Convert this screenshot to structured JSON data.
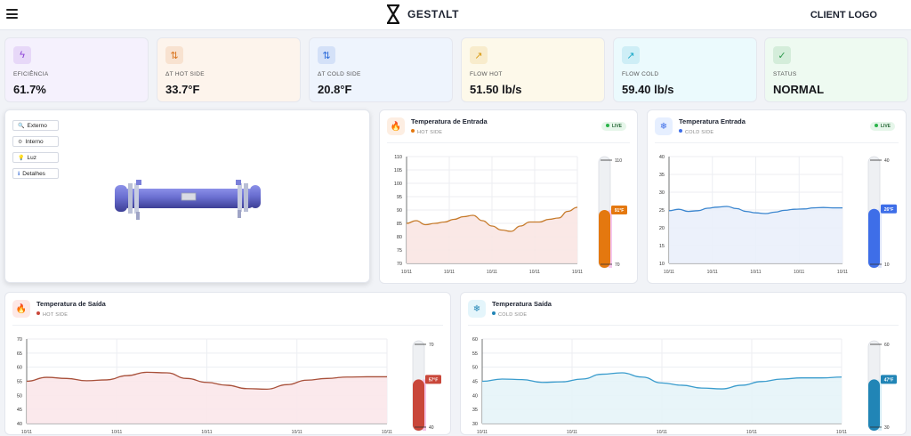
{
  "header": {
    "brand": "GESTΛLT",
    "client_logo": "CLIENT LOGO"
  },
  "kpis": [
    {
      "label": "EFICIÊNCIA",
      "value": "61.7%",
      "icon": "bolt-icon",
      "bg": "#f5f1fd",
      "accent": "#8b3fd6"
    },
    {
      "label": "ΔT HOT SIDE",
      "value": "33.7°F",
      "icon": "swap-vertical-icon",
      "bg": "#fdf4ec",
      "accent": "#d9731c"
    },
    {
      "label": "ΔT COLD SIDE",
      "value": "20.8°F",
      "icon": "swap-vertical-icon",
      "bg": "#eef4fd",
      "accent": "#2a6ad9"
    },
    {
      "label": "FLOW HOT",
      "value": "51.50 lb/s",
      "icon": "trend-up-icon",
      "bg": "#fdf9ea",
      "accent": "#d99a12"
    },
    {
      "label": "FLOW COLD",
      "value": "59.40 lb/s",
      "icon": "trend-up-icon",
      "bg": "#ebfafd",
      "accent": "#1aa8c8"
    },
    {
      "label": "STATUS",
      "value": "NORMAL",
      "icon": "check-circle-icon",
      "bg": "#eefaf1",
      "accent": "#2e9a4e"
    }
  ],
  "view_buttons": [
    {
      "label": "Externo",
      "icon": "search-icon"
    },
    {
      "label": "Interno",
      "icon": "gear-icon"
    },
    {
      "label": "Luz",
      "icon": "light-icon"
    },
    {
      "label": "Detalhes",
      "icon": "info-icon"
    }
  ],
  "live_label": "LIVE",
  "charts": [
    {
      "id": "c1",
      "title": "Temperatura de Entrada",
      "subtitle": "HOT SIDE",
      "icon": "flame-icon",
      "icon_bg": "#fdeee2",
      "color": "#c67a2a",
      "fill": "#f9e6e3",
      "thermo_color": "#e4780f",
      "thermo_glow": "#f6c7ee",
      "live": true,
      "gauge_value": "91°F",
      "gauge_max": "110",
      "gauge_min": "70",
      "chart_data": {
        "type": "area",
        "ylim": [
          70,
          110
        ],
        "yticks": [
          70,
          75,
          80,
          85,
          90,
          95,
          100,
          105,
          110
        ],
        "xticks": [
          "10/11",
          "10/11",
          "10/11",
          "10/11",
          "10/11"
        ],
        "values": [
          85,
          86,
          84.5,
          85,
          85.5,
          86.5,
          87.5,
          88,
          86,
          84,
          82.5,
          82,
          84,
          85.5,
          85.5,
          86.5,
          87,
          89.5,
          91
        ],
        "gauge_level": 0.52
      }
    },
    {
      "id": "c2",
      "title": "Temperatura Entrada",
      "subtitle": "COLD SIDE",
      "icon": "snowflake-icon",
      "icon_bg": "#e6efff",
      "color": "#3b86cf",
      "fill": "#eaf0fb",
      "thermo_color": "#3e6ee8",
      "thermo_glow": "#dfe6fb",
      "live": true,
      "gauge_value": "26°F",
      "gauge_max": "40",
      "gauge_min": "10",
      "chart_data": {
        "type": "area",
        "ylim": [
          10,
          40
        ],
        "yticks": [
          10,
          15,
          20,
          25,
          30,
          35,
          40
        ],
        "xticks": [
          "10/11",
          "10/11",
          "10/11",
          "10/11",
          "10/11"
        ],
        "values": [
          24.8,
          25.2,
          24.6,
          24.8,
          25.5,
          25.8,
          26,
          25.4,
          24.6,
          24.2,
          24.0,
          24.4,
          24.9,
          25.2,
          25.3,
          25.6,
          25.7,
          25.6,
          25.6
        ],
        "gauge_level": 0.53
      }
    },
    {
      "id": "c3",
      "title": "Temperatura de Saída",
      "subtitle": "HOT SIDE",
      "icon": "flame-icon",
      "icon_bg": "#fde8e6",
      "color": "#a8503a",
      "fill": "#fbe7ea",
      "thermo_color": "#c9473a",
      "thermo_glow": "#f4c4e8",
      "live": false,
      "gauge_value": "57°F",
      "gauge_max": "70",
      "gauge_min": "40",
      "chart_data": {
        "type": "area",
        "ylim": [
          40,
          70
        ],
        "yticks": [
          40,
          45,
          50,
          55,
          60,
          65,
          70
        ],
        "xticks": [
          "10/11",
          "10/11",
          "10/11",
          "10/11",
          "10/11"
        ],
        "values": [
          55,
          56.4,
          56,
          55.2,
          55.5,
          57,
          58.2,
          58,
          56,
          54.6,
          53.6,
          52.4,
          52.2,
          53.8,
          55.4,
          56,
          56.5,
          56.6,
          56.6
        ],
        "gauge_level": 0.57
      }
    },
    {
      "id": "c4",
      "title": "Temperatura Saída",
      "subtitle": "COLD SIDE",
      "icon": "snowflake-icon",
      "icon_bg": "#e4f5fb",
      "color": "#3a9ccd",
      "fill": "#e6f4f8",
      "thermo_color": "#2185b6",
      "thermo_glow": "#d6eef7",
      "live": false,
      "gauge_value": "47°F",
      "gauge_max": "60",
      "gauge_min": "30",
      "chart_data": {
        "type": "area",
        "ylim": [
          30,
          60
        ],
        "yticks": [
          30,
          35,
          40,
          45,
          50,
          55,
          60
        ],
        "xticks": [
          "10/11",
          "10/11",
          "10/11",
          "10/11",
          "10/11"
        ],
        "values": [
          45,
          45.8,
          45.6,
          44.6,
          44.8,
          45.8,
          47.5,
          48,
          46.5,
          44.4,
          43.6,
          42.6,
          42.3,
          43.6,
          44.9,
          45.8,
          46.2,
          46.2,
          46.5
        ],
        "gauge_level": 0.57
      }
    }
  ]
}
